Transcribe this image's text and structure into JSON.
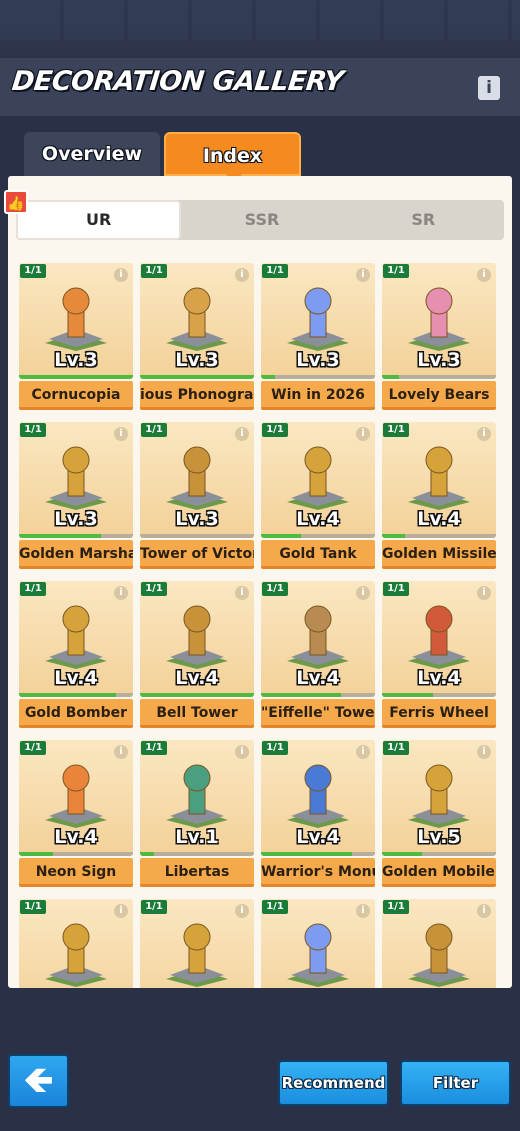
{
  "header": {
    "title": "DECORATION GALLERY",
    "info_icon": "i"
  },
  "tabs": [
    {
      "label": "Overview"
    },
    {
      "label": "Index"
    }
  ],
  "rarity_tabs": [
    {
      "label": "UR",
      "active": true
    },
    {
      "label": "SSR"
    },
    {
      "label": "SR"
    }
  ],
  "cards": [
    {
      "count": "1/1",
      "level": "Lv.3",
      "name": "Cornucopia",
      "color": "#e58a3a",
      "progress": 1.0
    },
    {
      "count": "1/1",
      "level": "Lv.3",
      "name": "ious Phonograph",
      "color": "#d8a24a",
      "progress": 1.0
    },
    {
      "count": "1/1",
      "level": "Lv.3",
      "name": "Win in 2026",
      "color": "#7d9bf0",
      "progress": 0.12
    },
    {
      "count": "1/1",
      "level": "Lv.3",
      "name": "Lovely Bears",
      "color": "#e78fb1",
      "progress": 0.15
    },
    {
      "count": "1/1",
      "level": "Lv.3",
      "name": "Golden Marshal S",
      "color": "#d6a33a",
      "progress": 0.72
    },
    {
      "count": "1/1",
      "level": "Lv.3",
      "name": "Tower of Victory",
      "color": "#c8923a",
      "progress": 0.0
    },
    {
      "count": "1/1",
      "level": "Lv.4",
      "name": "Gold Tank",
      "color": "#d6a33a",
      "progress": 0.35
    },
    {
      "count": "1/1",
      "level": "Lv.4",
      "name": "Golden Missile V",
      "color": "#d6a33a",
      "progress": 0.2
    },
    {
      "count": "1/1",
      "level": "Lv.4",
      "name": "Gold Bomber",
      "color": "#d6a33a",
      "progress": 0.85
    },
    {
      "count": "1/1",
      "level": "Lv.4",
      "name": "Bell Tower",
      "color": "#c8923a",
      "progress": 1.0
    },
    {
      "count": "1/1",
      "level": "Lv.4",
      "name": "\"Eiffelle\" Tower",
      "color": "#b88b52",
      "progress": 0.7
    },
    {
      "count": "1/1",
      "level": "Lv.4",
      "name": "Ferris Wheel",
      "color": "#d05a3a",
      "progress": 0.45
    },
    {
      "count": "1/1",
      "level": "Lv.4",
      "name": "Neon Sign",
      "color": "#e9843a",
      "progress": 0.3
    },
    {
      "count": "1/1",
      "level": "Lv.1",
      "name": "Libertas",
      "color": "#4a9f7e",
      "progress": 0.12
    },
    {
      "count": "1/1",
      "level": "Lv.4",
      "name": "Warrior's Monum",
      "color": "#4b7ad6",
      "progress": 0.8
    },
    {
      "count": "1/1",
      "level": "Lv.5",
      "name": "Golden Mobile Sv",
      "color": "#d6a33a",
      "progress": 0.35
    },
    {
      "count": "1/1",
      "level": "",
      "name": "",
      "color": "#d6a33a",
      "progress": 0
    },
    {
      "count": "1/1",
      "level": "",
      "name": "",
      "color": "#d6a33a",
      "progress": 0
    },
    {
      "count": "1/1",
      "level": "",
      "name": "",
      "color": "#7d9bf0",
      "progress": 0
    },
    {
      "count": "1/1",
      "level": "",
      "name": "",
      "color": "#c8923a",
      "progress": 0
    }
  ],
  "footer": {
    "back_icon": "🡸",
    "recommend_label": "Recommend",
    "filter_label": "Filter"
  }
}
